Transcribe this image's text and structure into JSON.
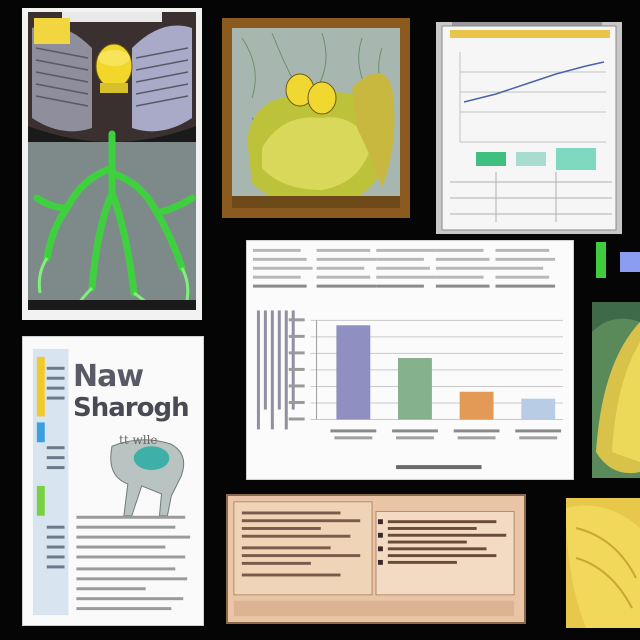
{
  "collage": {
    "poster": {
      "title_line1": "Naw",
      "title_line2": "Sharogh",
      "subtitle": "tt wlle"
    }
  },
  "colors": {
    "background": "#050505",
    "bar1": "#8f8fc2",
    "bar2": "#86b18d",
    "bar3": "#e39a57",
    "bar4": "#b9cce6",
    "frame_brown": "#8a5a1e",
    "leaf_yellow": "#d9c24a",
    "tree_green": "#4fd04a"
  },
  "chart_data": {
    "type": "bar",
    "categories": [
      "",
      "",
      "",
      ""
    ],
    "values": [
      95,
      62,
      28,
      21
    ],
    "ylim": [
      0,
      100
    ],
    "grid": true
  }
}
